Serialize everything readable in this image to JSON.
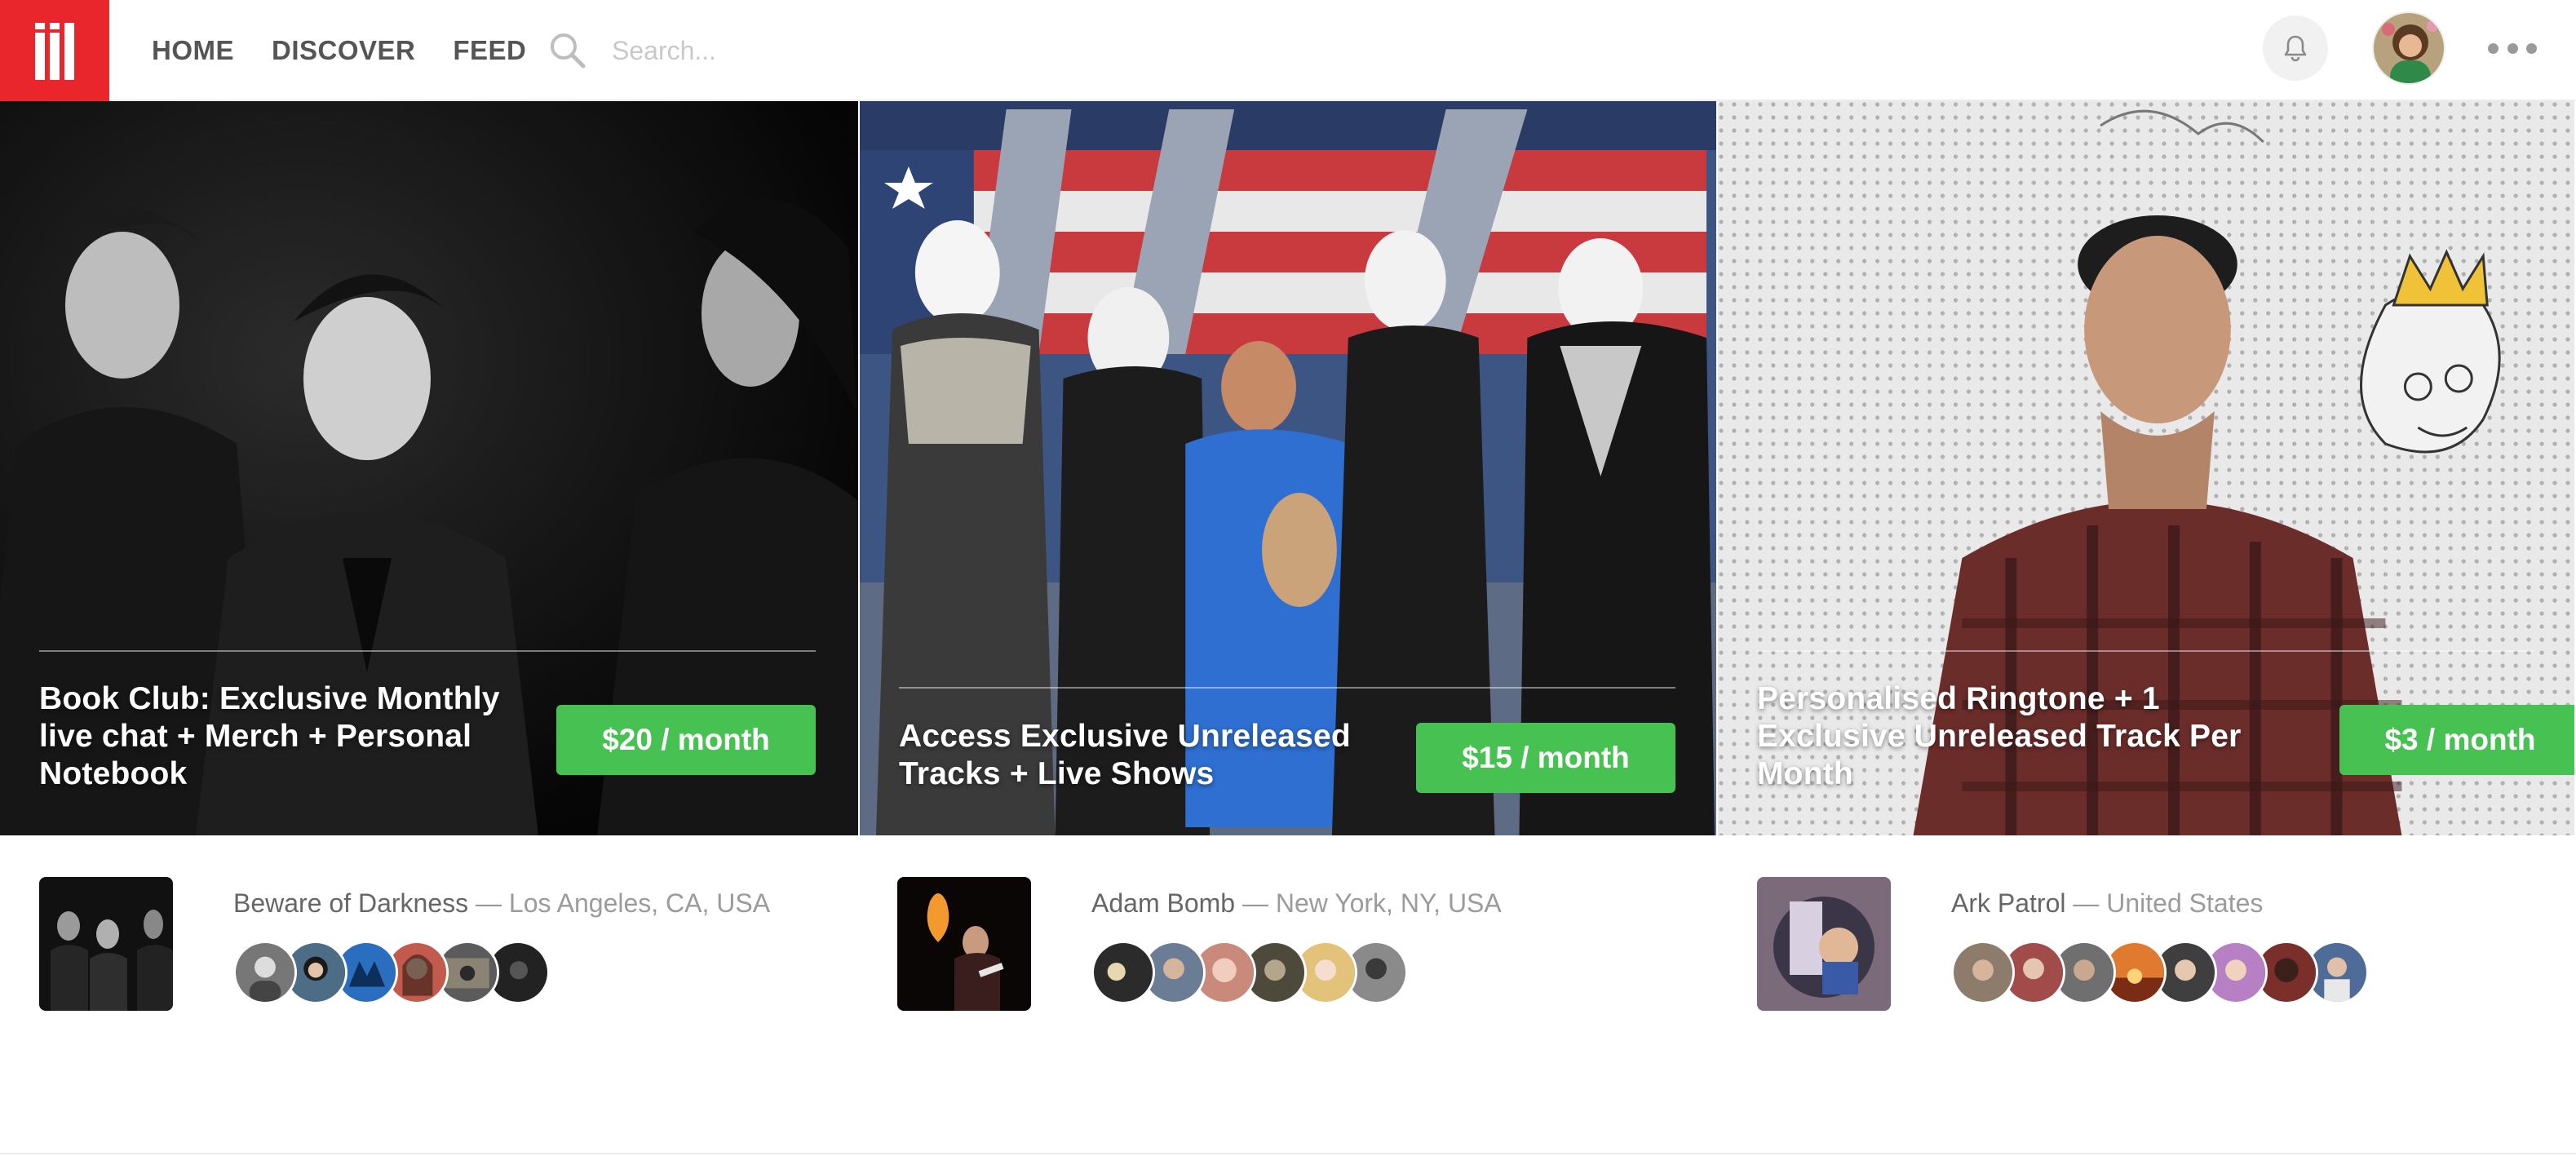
{
  "app": {
    "logo_icon": "patreon-style-bars-logo",
    "brand_color": "#e8262c",
    "accent_green": "#47c151"
  },
  "nav": {
    "items": [
      "HOME",
      "DISCOVER",
      "FEED"
    ]
  },
  "search": {
    "placeholder": "Search...",
    "icon": "search-icon"
  },
  "header_actions": {
    "bell_icon": "bell-icon",
    "avatar": "user-avatar",
    "more_icon": "more-dots-icon"
  },
  "tiles": [
    {
      "title": "Book Club: Exclusive Monthly live chat + Merch + Personal Notebook",
      "price": "$20 / month"
    },
    {
      "title": "Access Exclusive Unreleased Tracks + Live Shows",
      "price": "$15 / month"
    },
    {
      "title": "Personalised Ringtone + 1 Exclusive Unreleased Track Per Month",
      "price": "$3 / month"
    }
  ],
  "artists": [
    {
      "name": "Beware of Darkness",
      "separator": "—",
      "location": "Los Angeles, CA, USA",
      "fan_colors": [
        "#777777",
        "#4d6c86",
        "#2a6fbf",
        "#c25b4d",
        "#5b5b5b",
        "#222222"
      ]
    },
    {
      "name": "Adam Bomb",
      "separator": "—",
      "location": "New York, NY, USA",
      "fan_colors": [
        "#2b2b2b",
        "#6a7d95",
        "#c98a7b",
        "#4d4a3c",
        "#e3c27a",
        "#8a8a8a"
      ]
    },
    {
      "name": "Ark Patrol",
      "separator": "—",
      "location": "United States",
      "fan_colors": [
        "#8d7c6b",
        "#a14b4b",
        "#6f6f6f",
        "#e07a2e",
        "#3f3f3f",
        "#b77fc4",
        "#7a2f2a",
        "#4f6b98"
      ]
    }
  ]
}
